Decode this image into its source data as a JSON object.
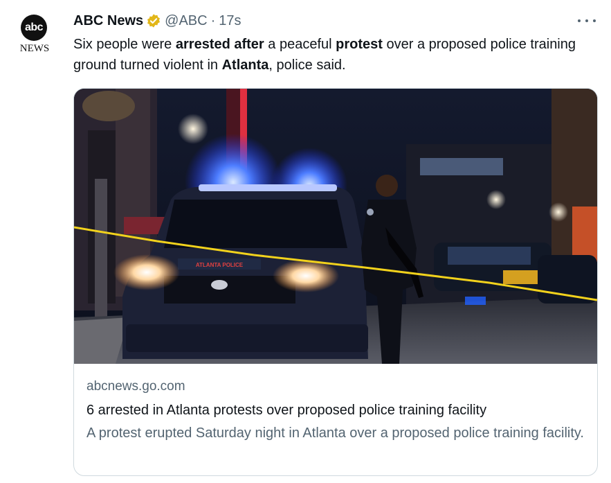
{
  "tweet": {
    "author": {
      "avatar_logo_text": "abc",
      "avatar_sub_text": "NEWS",
      "name": "ABC News",
      "handle": "@ABC",
      "separator": "·",
      "time": "17s",
      "verified_color": "#E2B719"
    },
    "text_segments": [
      {
        "text": "Six people were ",
        "bold": false
      },
      {
        "text": "arrested after",
        "bold": true
      },
      {
        "text": " a peaceful ",
        "bold": false
      },
      {
        "text": "protest",
        "bold": true
      },
      {
        "text": " over a proposed police training ground turned violent in ",
        "bold": false
      },
      {
        "text": "Atlanta",
        "bold": true
      },
      {
        "text": ", police said.",
        "bold": false
      }
    ],
    "card": {
      "image_alt": "Police officer standing in front of police SUV at night",
      "car_lettering": "ATLANTA POLICE",
      "domain": "abcnews.go.com",
      "title": "6 arrested in Atlanta protests over proposed police training facility",
      "description": "A protest erupted Saturday night in Atlanta over a proposed police training facility."
    },
    "icons": {
      "verified": "verified-badge-icon",
      "more": "more-dots-icon"
    }
  }
}
